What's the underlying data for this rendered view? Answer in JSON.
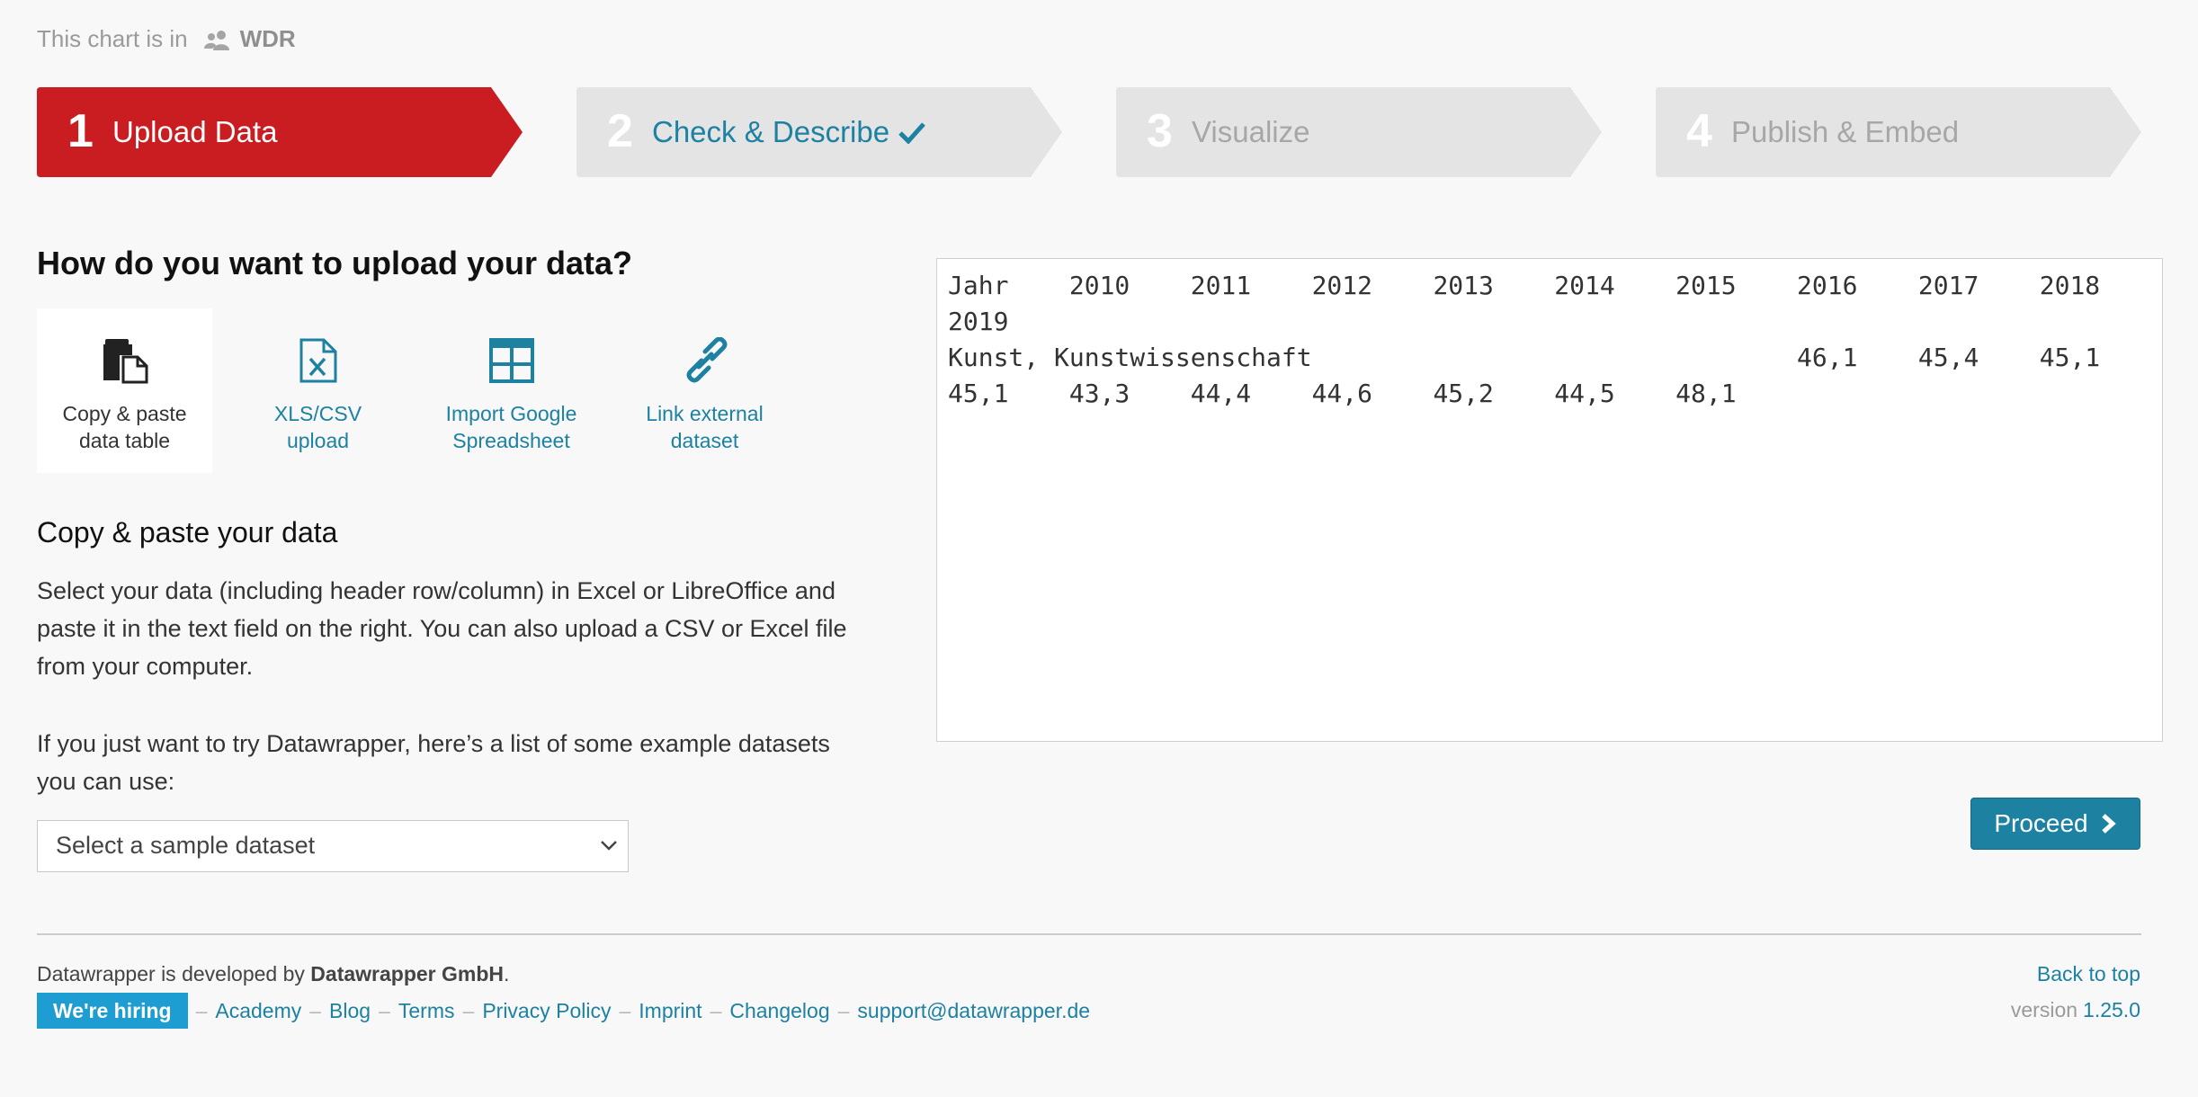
{
  "header": {
    "chart_in_label": "This chart is in",
    "team_name": "WDR"
  },
  "steps": [
    {
      "number": "1",
      "label": "Upload Data",
      "state": "active"
    },
    {
      "number": "2",
      "label": "Check & Describe",
      "state": "done"
    },
    {
      "number": "3",
      "label": "Visualize",
      "state": "pending"
    },
    {
      "number": "4",
      "label": "Publish & Embed",
      "state": "pending"
    }
  ],
  "upload": {
    "heading": "How do you want to upload your data?",
    "methods": [
      {
        "icon": "copy-paste-icon",
        "line1": "Copy & paste",
        "line2": "data table",
        "active": true
      },
      {
        "icon": "xls-file-icon",
        "line1": "XLS/CSV",
        "line2": "upload",
        "active": false
      },
      {
        "icon": "spreadsheet-grid-icon",
        "line1": "Import Google",
        "line2": "Spreadsheet",
        "active": false
      },
      {
        "icon": "link-icon",
        "line1": "Link external",
        "line2": "dataset",
        "active": false
      }
    ]
  },
  "paste": {
    "heading": "Copy & paste your data",
    "description": "Select your data (including header row/column) in Excel or LibreOffice and paste it in the text field on the right. You can also upload a CSV or Excel file from your computer.",
    "example_text": "If you just want to try Datawrapper, here’s a list of some example datasets you can use:",
    "sample_select_value": "Select a sample dataset"
  },
  "data_text": "Jahr\t2010\t2011\t2012\t2013\t2014\t2015\t2016\t2017\t2018\t2019\nKunst, Kunstwissenschaft\t\t\t\t46,1\t45,4\t45,1\t45,1\t43,3\t44,4\t44,6\t45,2\t44,5\t48,1",
  "proceed_label": "Proceed",
  "footer": {
    "developed_prefix": "Datawrapper is developed by ",
    "company": "Datawrapper GmbH",
    "developed_suffix": ".",
    "hiring": "We're hiring",
    "links": [
      "Academy",
      "Blog",
      "Terms",
      "Privacy Policy",
      "Imprint",
      "Changelog",
      "support@datawrapper.de"
    ],
    "back_to_top": "Back to top",
    "version_label": "version",
    "version_number": "1.25.0"
  },
  "colors": {
    "active_step": "#c91d22",
    "inactive_step": "#e4e4e4",
    "accent": "#1d81a2",
    "hiring_badge": "#1d9dd1"
  }
}
